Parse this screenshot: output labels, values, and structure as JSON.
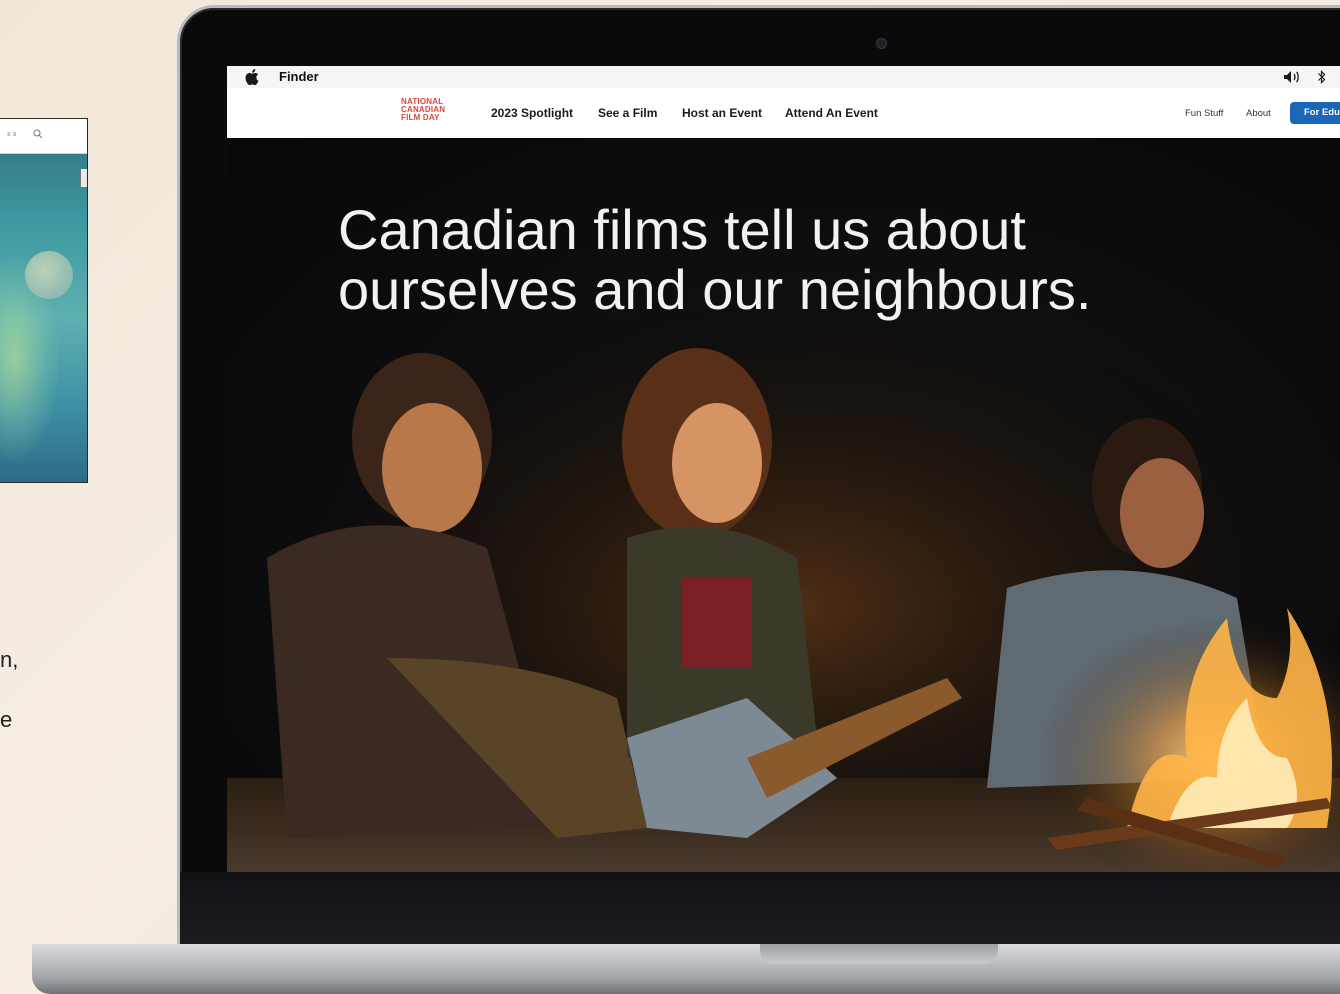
{
  "menubar": {
    "app_name": "Finder"
  },
  "site": {
    "logo_lines": [
      "NATIONAL",
      "CANADIAN",
      "FILM DAY"
    ],
    "nav": [
      "2023 Spotlight",
      "See a Film",
      "Host an Event",
      "Attend An Event"
    ],
    "nav_right": [
      "Fun Stuff",
      "About"
    ],
    "cta": "For Edu"
  },
  "hero": {
    "headline_line1": "Canadian films tell us about",
    "headline_line2": "ourselves and our neighbours."
  },
  "side": {
    "caption_chars": [
      "n,",
      "e"
    ]
  },
  "colors": {
    "logo": "#d9473a",
    "cta": "#1b67b5"
  }
}
